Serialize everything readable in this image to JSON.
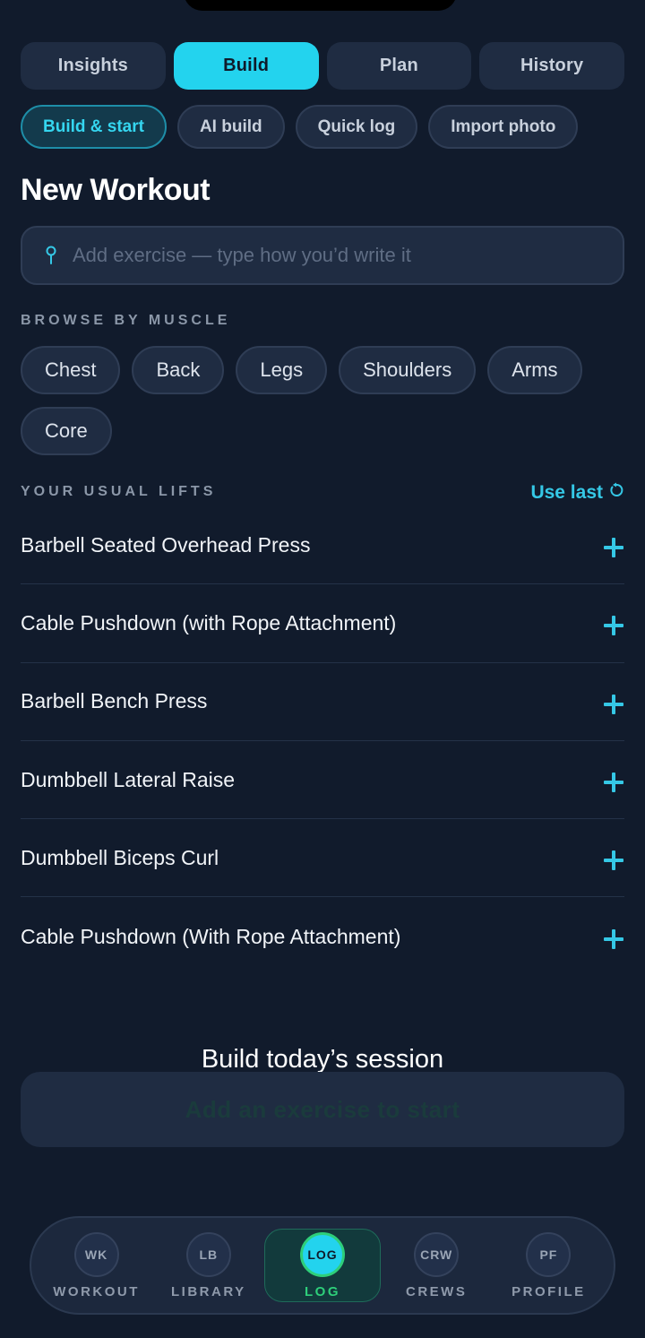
{
  "tabs": [
    {
      "label": "Insights",
      "active": false
    },
    {
      "label": "Build",
      "active": true
    },
    {
      "label": "Plan",
      "active": false
    },
    {
      "label": "History",
      "active": false
    }
  ],
  "subtabs": [
    {
      "label": "Build & start",
      "active": true
    },
    {
      "label": "AI build",
      "active": false
    },
    {
      "label": "Quick log",
      "active": false
    },
    {
      "label": "Import photo",
      "active": false
    }
  ],
  "page_title": "New Workout",
  "search": {
    "placeholder": "Add exercise — type how you’d write it",
    "value": "",
    "icon": "pin-icon"
  },
  "browse": {
    "label": "BROWSE BY MUSCLE",
    "muscles": [
      "Chest",
      "Back",
      "Legs",
      "Shoulders",
      "Arms",
      "Core"
    ]
  },
  "usual_lifts": {
    "label": "YOUR USUAL LIFTS",
    "use_last_label": "Use last",
    "items": [
      "Barbell Seated Overhead Press",
      "Cable Pushdown (with Rope Attachment)",
      "Barbell Bench Press",
      "Dumbbell Lateral Raise",
      "Dumbbell Biceps Curl",
      "Cable Pushdown (With Rope Attachment)"
    ]
  },
  "session": {
    "title": "Build today’s session",
    "start_label": "Add an exercise to start"
  },
  "bottom_nav": [
    {
      "abbr": "WK",
      "label": "WORKOUT",
      "active": false
    },
    {
      "abbr": "LB",
      "label": "LIBRARY",
      "active": false
    },
    {
      "abbr": "LOG",
      "label": "LOG",
      "active": true
    },
    {
      "abbr": "CRW",
      "label": "CREWS",
      "active": false
    },
    {
      "abbr": "PF",
      "label": "PROFILE",
      "active": false
    }
  ],
  "colors": {
    "background": "#111b2c",
    "accent": "#23d3ee",
    "active_nav": "#2ecf7a",
    "surface": "#1f2c42"
  }
}
